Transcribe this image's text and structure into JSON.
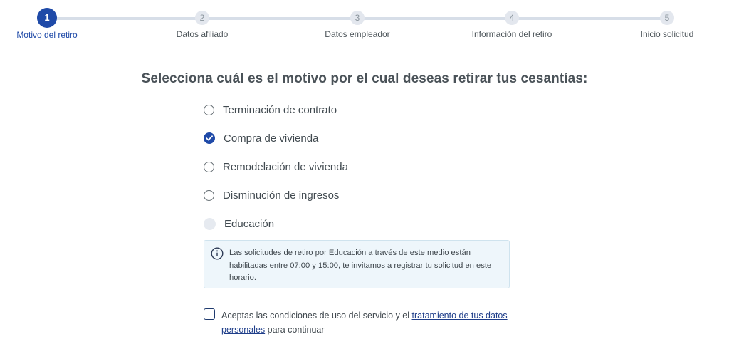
{
  "stepper": {
    "steps": [
      {
        "number": "1",
        "label": "Motivo del retiro",
        "state": "current"
      },
      {
        "number": "2",
        "label": "Datos afiliado",
        "state": "pending"
      },
      {
        "number": "3",
        "label": "Datos empleador",
        "state": "pending"
      },
      {
        "number": "4",
        "label": "Información del retiro",
        "state": "pending"
      },
      {
        "number": "5",
        "label": "Inicio solicitud",
        "state": "pending"
      }
    ]
  },
  "main": {
    "title": "Selecciona cuál es el motivo por el cual deseas retirar tus cesantías:",
    "options": [
      {
        "label": "Terminación de contrato",
        "state": "unchecked"
      },
      {
        "label": "Compra de vivienda",
        "state": "checked"
      },
      {
        "label": "Remodelación de vivienda",
        "state": "unchecked"
      },
      {
        "label": "Disminución de ingresos",
        "state": "unchecked"
      },
      {
        "label": "Educación",
        "state": "disabled"
      }
    ],
    "info": {
      "icon": "info-icon",
      "text": "Las solicitudes de retiro por Educación a través de este medio están habilitadas entre 07:00 y 15:00, te invitamos a registrar tu solicitud en este horario."
    },
    "terms": {
      "checked": false,
      "text_before": "Aceptas las condiciones de uso del servicio y el ",
      "link_text": "tratamiento de tus datos personales",
      "text_after": " para continuar"
    }
  },
  "colors": {
    "primary": "#1f4aa8",
    "step_inactive": "#e3e7ee",
    "info_bg": "#eef6fb",
    "text": "#414a50"
  }
}
